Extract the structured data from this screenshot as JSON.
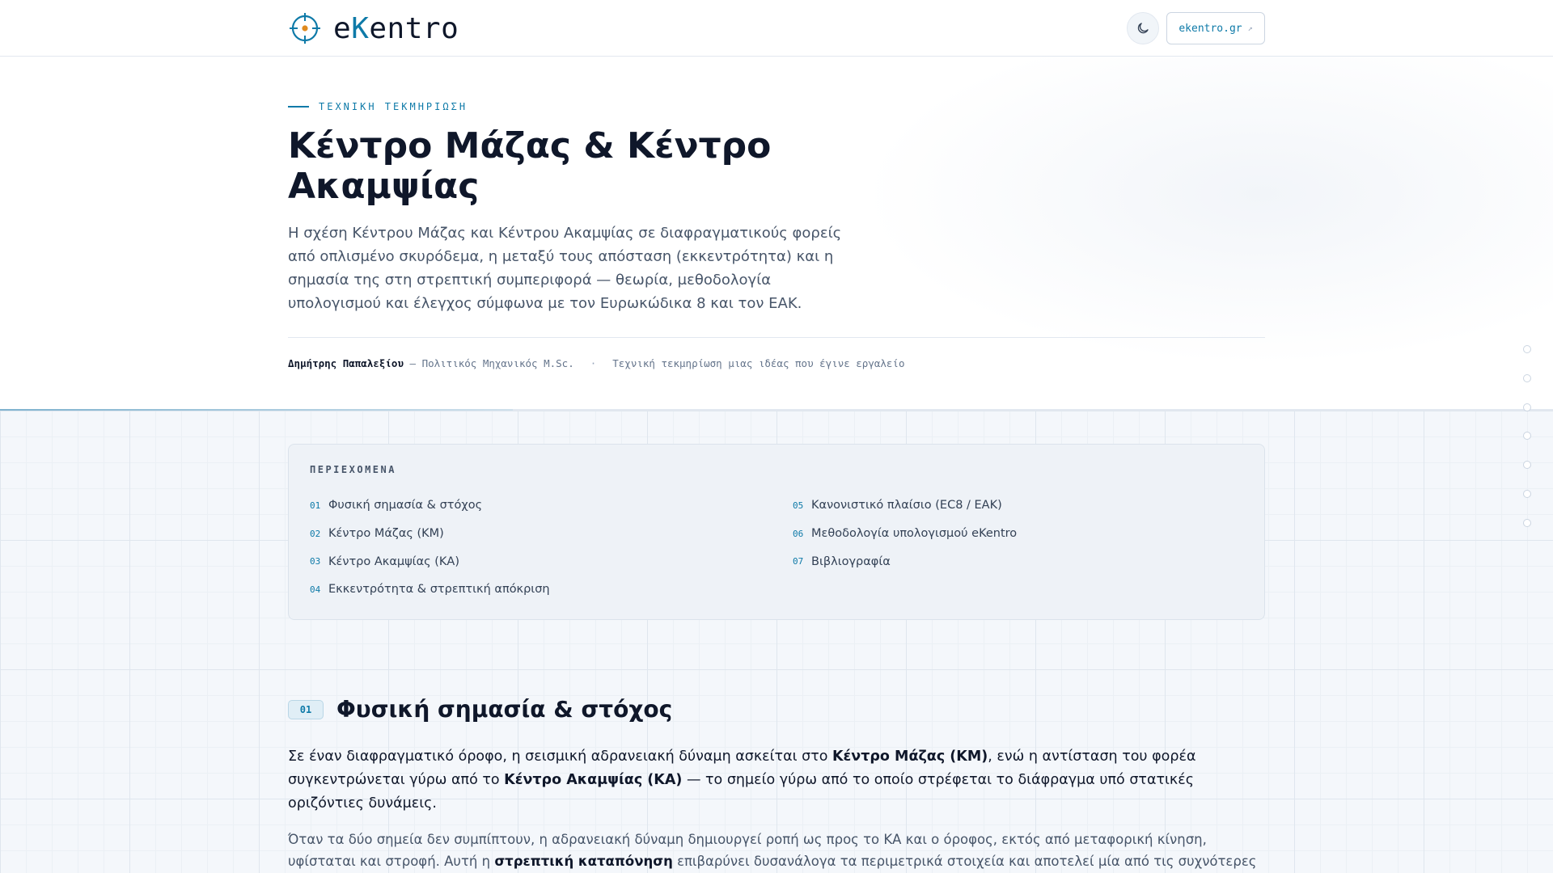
{
  "header": {
    "brand_prefix": "e",
    "brand_accent": "K",
    "brand_suffix": "entro",
    "site_label": "ekentro.gr",
    "site_external_glyph": "↗"
  },
  "hero": {
    "eyebrow": "ΤΕΧΝΙΚΗ ΤΕΚΜΗΡΙΩΣΗ",
    "title": "Κέντρο Μάζας & Κέντρο Ακαμψίας",
    "lead": "Η σχέση Κέντρου Μάζας και Κέντρου Ακαμψίας σε διαφραγματικούς φορείς από οπλισμένο σκυρόδεμα, η μεταξύ τους απόσταση (εκκεντρότητα) και η σημασία της στη στρεπτική συμπεριφορά — θεωρία, μεθοδολογία υπολογισμού και έλεγχος σύμφωνα με τον Ευρωκώδικα 8 και τον ΕΑΚ.",
    "author": "Δημήτρης Παπαλεξίου",
    "author_role": " — Πολιτικός Μηχανικός M.Sc.",
    "separator": "·",
    "tagline": "Τεχνική τεκμηρίωση μιας ιδέας που έγινε εργαλείο"
  },
  "reading_progress": 0.33,
  "toc": {
    "title": "ΠΕΡΙΕΧΟΜΕΝΑ",
    "left": [
      {
        "num": "01",
        "label": "Φυσική σημασία & στόχος"
      },
      {
        "num": "02",
        "label": "Κέντρο Μάζας (ΚΜ)"
      },
      {
        "num": "03",
        "label": "Κέντρο Ακαμψίας (ΚΑ)"
      },
      {
        "num": "04",
        "label": "Εκκεντρότητα & στρεπτική απόκριση"
      }
    ],
    "right": [
      {
        "num": "05",
        "label": "Κανονιστικό πλαίσιο (EC8 / ΕΑΚ)"
      },
      {
        "num": "06",
        "label": "Μεθοδολογία υπολογισμού eKentro"
      },
      {
        "num": "07",
        "label": "Βιβλιογραφία"
      }
    ]
  },
  "section1": {
    "num": "01",
    "title": "Φυσική σημασία & στόχος",
    "p1_a": "Σε έναν διαφραγματικό όροφο, η σεισμική αδρανειακή δύναμη ασκείται στο ",
    "p1_b": "Κέντρο Μάζας (ΚΜ)",
    "p1_c": ", ενώ η αντίσταση του φορέα συγκεντρώνεται γύρω από το ",
    "p1_d": "Κέντρο Ακαμψίας (ΚΑ)",
    "p1_e": " — το σημείο γύρω από το οποίο στρέφεται το διάφραγμα υπό στατικές οριζόντιες δυνάμεις.",
    "p2_a": "Όταν τα δύο σημεία δεν συμπίπτουν, η αδρανειακή δύναμη δημιουργεί ροπή ως προς το ΚΑ και ο όροφος, εκτός από μεταφορική κίνηση, υφίσταται και στροφή. Αυτή η ",
    "p2_b": "στρεπτική καταπόνηση",
    "p2_c": " επιβαρύνει δυσανάλογα τα περιμετρικά στοιχεία και αποτελεί μία από τις συχνότερες αιτίες μη"
  },
  "side_nav_count": 7,
  "icons": {
    "logo": "target-crosshair-icon",
    "theme": "moon-icon",
    "external": "external-link-icon"
  },
  "colors": {
    "accent": "#0e7aa8",
    "text": "#0f172a",
    "muted": "#475569"
  }
}
